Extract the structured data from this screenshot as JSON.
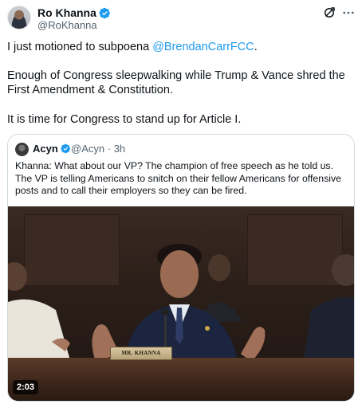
{
  "author": {
    "name": "Ro Khanna",
    "handle": "@RoKhanna"
  },
  "post": {
    "line1_prefix": "I just motioned to subpoena ",
    "line1_mention": "@BrendanCarrFCC",
    "line1_suffix": ".",
    "para2": "Enough of Congress sleepwalking while Trump & Vance shred the First Amendment & Constitution.",
    "para3": "It is time for Congress to stand up for Article I."
  },
  "quote": {
    "name": "Acyn",
    "handle": "@Acyn",
    "separator": "·",
    "time": "3h",
    "text": "Khanna: What about our VP? The champion of free speech as he told us. The VP is telling Americans to snitch on their fellow Americans for offensive posts and to call their employers so they can be fired.",
    "video": {
      "nameplate": "MR. KHANNA",
      "duration": "2:03"
    }
  },
  "icons": {
    "verified": "verified-badge-icon",
    "grok": "grok-icon",
    "more": "more-dots-icon"
  },
  "colors": {
    "link": "#1d9bf0",
    "text": "#0f1419",
    "secondary": "#536471",
    "border": "#cfd9de"
  }
}
